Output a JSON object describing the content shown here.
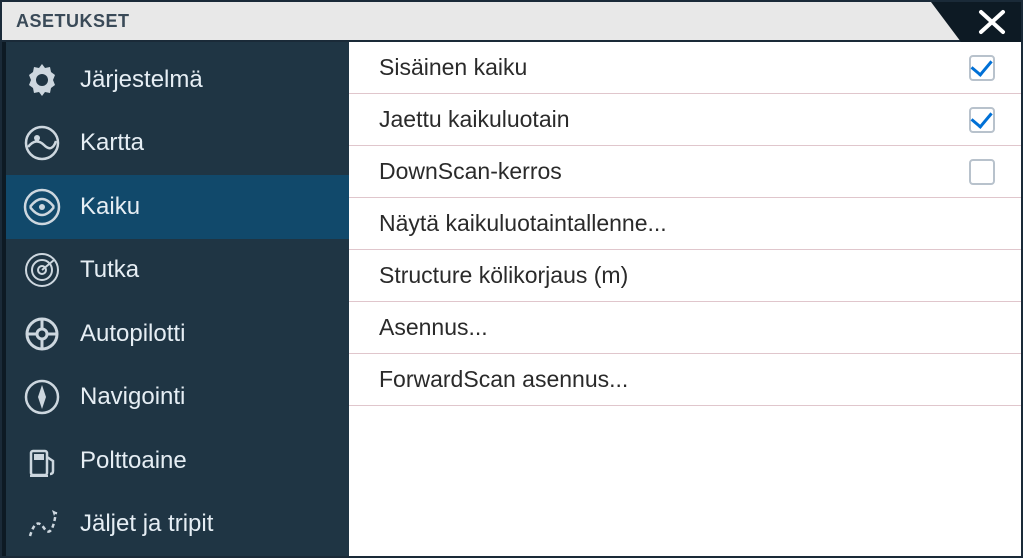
{
  "title": "ASETUKSET",
  "sidebar": {
    "items": [
      {
        "id": "system",
        "label": "Järjestelmä",
        "icon": "gear",
        "selected": false
      },
      {
        "id": "chart",
        "label": "Kartta",
        "icon": "globe",
        "selected": false
      },
      {
        "id": "echo",
        "label": "Kaiku",
        "icon": "sonar",
        "selected": true
      },
      {
        "id": "radar",
        "label": "Tutka",
        "icon": "radar",
        "selected": false
      },
      {
        "id": "autopilot",
        "label": "Autopilotti",
        "icon": "wheel",
        "selected": false
      },
      {
        "id": "nav",
        "label": "Navigointi",
        "icon": "compass",
        "selected": false
      },
      {
        "id": "fuel",
        "label": "Polttoaine",
        "icon": "fuel",
        "selected": false
      },
      {
        "id": "tracks",
        "label": "Jäljet ja tripit",
        "icon": "route",
        "selected": false
      }
    ]
  },
  "settings": {
    "rows": [
      {
        "id": "internal_echo",
        "label": "Sisäinen kaiku",
        "type": "checkbox",
        "checked": true
      },
      {
        "id": "shared_sonar",
        "label": "Jaettu kaikuluotain",
        "type": "checkbox",
        "checked": true
      },
      {
        "id": "downscan_layer",
        "label": "DownScan-kerros",
        "type": "checkbox",
        "checked": false
      },
      {
        "id": "show_record",
        "label": "Näytä kaikuluotaintallenne...",
        "type": "link"
      },
      {
        "id": "keel_offset",
        "label": "Structure kölikorjaus (m)",
        "type": "link"
      },
      {
        "id": "install",
        "label": "Asennus...",
        "type": "link"
      },
      {
        "id": "fwdscan_install",
        "label": "ForwardScan asennus...",
        "type": "link"
      }
    ]
  }
}
